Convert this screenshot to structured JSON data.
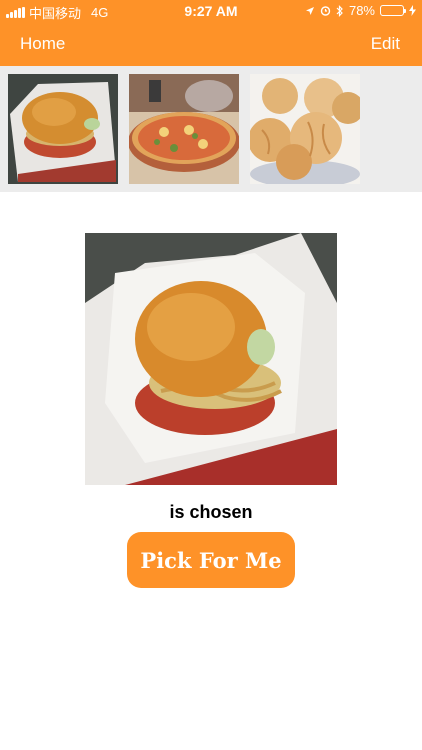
{
  "status_bar": {
    "carrier": "中国移动",
    "network": "4G",
    "time": "9:27 AM",
    "battery_percent": "78%",
    "battery_level": 0.78,
    "icons": [
      "signal-icon",
      "location-icon",
      "alarm-icon",
      "bluetooth-icon",
      "battery-icon",
      "charging-icon"
    ]
  },
  "nav": {
    "home_label": "Home",
    "edit_label": "Edit"
  },
  "thumbnails": [
    {
      "name": "burger"
    },
    {
      "name": "pizza"
    },
    {
      "name": "bread-rolls"
    }
  ],
  "selection": {
    "image": "burger",
    "caption": "is chosen"
  },
  "action": {
    "pick_label": "Pick For Me"
  },
  "colors": {
    "accent": "#FE9228",
    "strip_bg": "#ECECEC",
    "battery_fill": "#4cd964"
  }
}
